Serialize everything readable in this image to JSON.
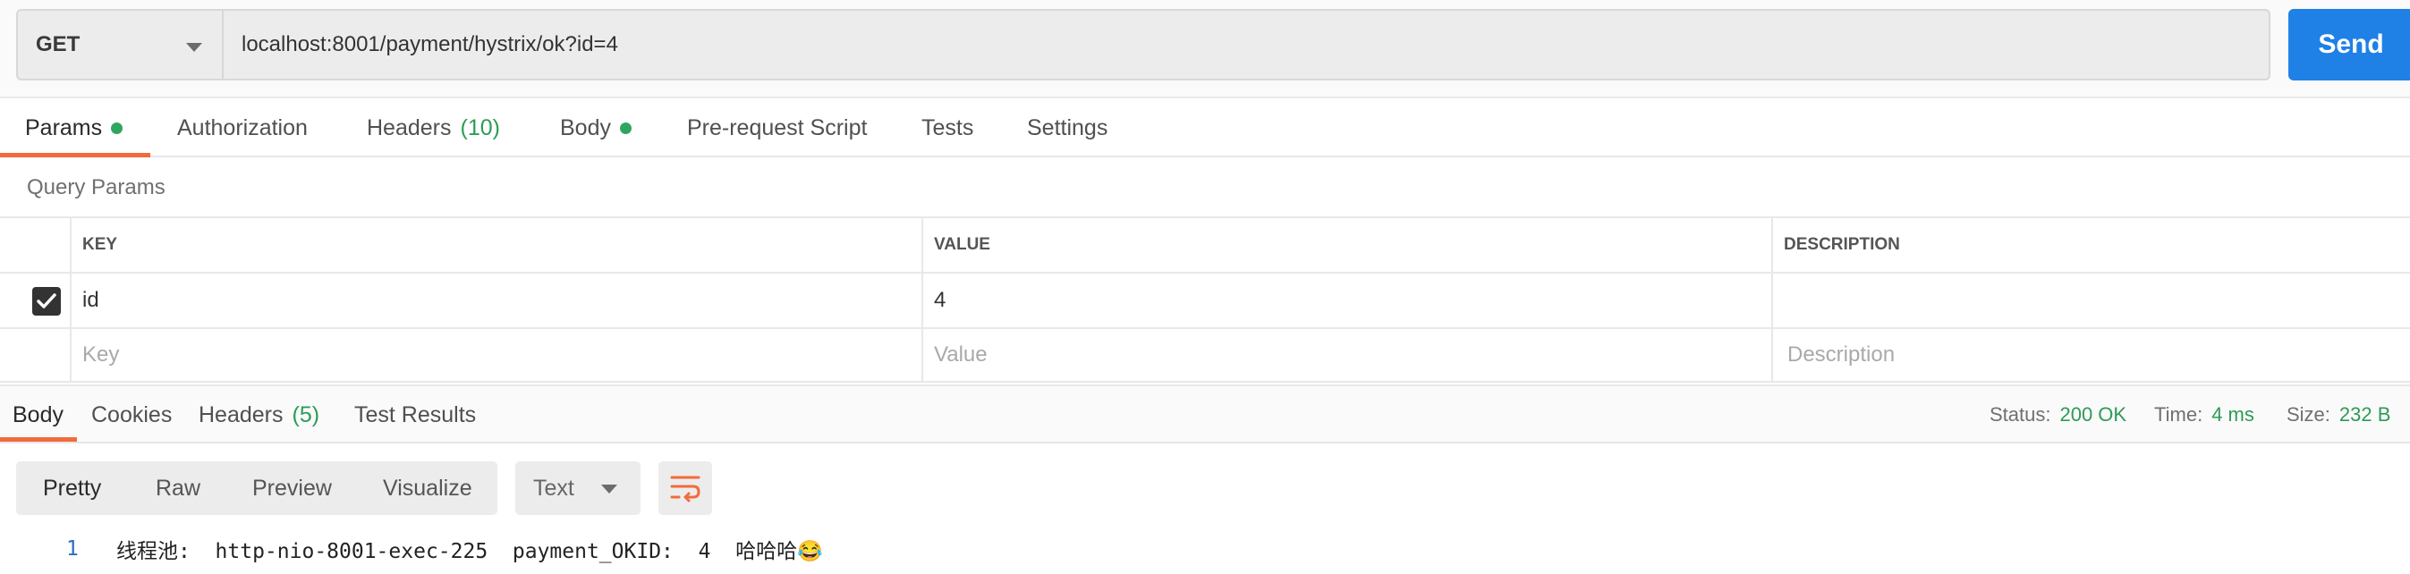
{
  "request": {
    "method": "GET",
    "url": "localhost:8001/payment/hystrix/ok?id=4",
    "send_label": "Send"
  },
  "request_tabs": {
    "params": "Params",
    "authorization": "Authorization",
    "headers": "Headers",
    "headers_count": "(10)",
    "body": "Body",
    "prerequest": "Pre-request Script",
    "tests": "Tests",
    "settings": "Settings"
  },
  "query_params": {
    "title": "Query Params",
    "columns": {
      "key": "KEY",
      "value": "VALUE",
      "description": "DESCRIPTION"
    },
    "rows": [
      {
        "checked": true,
        "key": "id",
        "value": "4",
        "description": ""
      }
    ],
    "placeholders": {
      "key": "Key",
      "value": "Value",
      "description": "Description"
    }
  },
  "response_tabs": {
    "body": "Body",
    "cookies": "Cookies",
    "headers": "Headers",
    "headers_count": "(5)",
    "test_results": "Test Results"
  },
  "response_status": {
    "status_label": "Status:",
    "status_value": "200 OK",
    "time_label": "Time:",
    "time_value": "4 ms",
    "size_label": "Size:",
    "size_value": "232 B"
  },
  "body_toolbar": {
    "pretty": "Pretty",
    "raw": "Raw",
    "preview": "Preview",
    "visualize": "Visualize",
    "format": "Text",
    "wrap_icon": "wrap-lines-icon"
  },
  "response_body": {
    "lines": [
      {
        "number": "1",
        "text": "线程池:  http-nio-8001-exec-225  payment_OKID:  4  哈哈哈😂"
      }
    ]
  },
  "colors": {
    "accent": "#f26b3a",
    "send": "#1f80e6",
    "success": "#2d9b57"
  }
}
